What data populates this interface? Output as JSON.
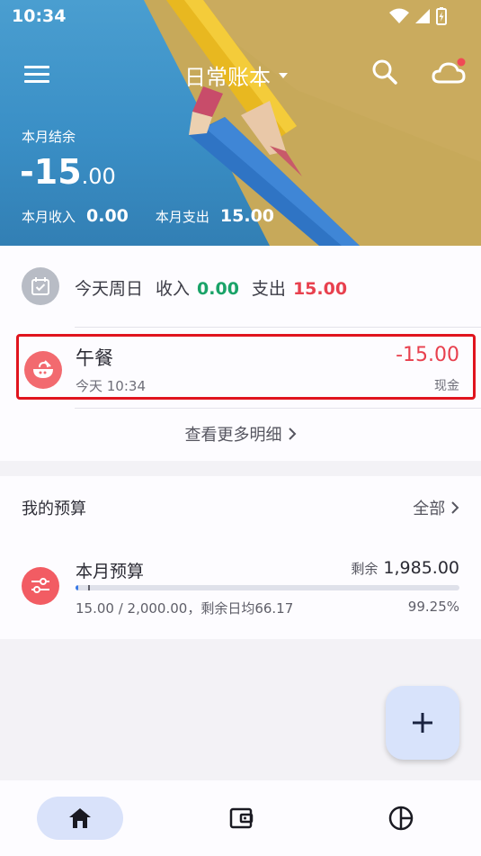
{
  "status_bar": {
    "time": "10:34"
  },
  "header": {
    "title": "日常账本",
    "balance_label": "本月结余",
    "balance_int": "-15",
    "balance_dec": ".00",
    "income_label": "本月收入",
    "income_value": "0.00",
    "expense_label": "本月支出",
    "expense_value": "15.00"
  },
  "today": {
    "label": "今天周日",
    "income_label": "收入",
    "income_value": "0.00",
    "expense_label": "支出",
    "expense_value": "15.00"
  },
  "record": {
    "name": "午餐",
    "time": "今天 10:34",
    "amount": "-15.00",
    "account": "现金"
  },
  "more_link": "查看更多明细",
  "budget": {
    "section_title": "我的预算",
    "all_label": "全部",
    "name": "本月预算",
    "remain_label": "剩余",
    "remain_value": "1,985.00",
    "detail": "15.00 / 2,000.00，剩余日均66.17",
    "percent": "99.25%",
    "used_fraction": 0.0075
  },
  "icons": {
    "menu": "menu-icon",
    "dropdown": "caret-down-icon",
    "search": "search-icon",
    "cloud": "cloud-sync-icon",
    "calendar": "calendar-check-icon",
    "food": "rice-bowl-icon",
    "budget": "sliders-icon",
    "add": "plus-icon",
    "home": "home-icon",
    "wallet": "wallet-icon",
    "stats": "pie-chart-icon"
  },
  "colors": {
    "income": "#1aa368",
    "expense": "#e8404e",
    "highlight_border": "#e0141e",
    "accent": "#3778e6",
    "nav_active_bg": "#d9e2fa"
  }
}
